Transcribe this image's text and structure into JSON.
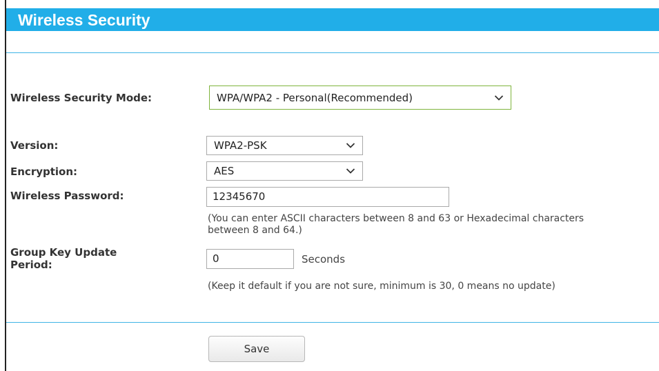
{
  "page": {
    "title": "Wireless Security"
  },
  "form": {
    "security_mode": {
      "label": "Wireless Security Mode:",
      "value": "WPA/WPA2 - Personal(Recommended)"
    },
    "version": {
      "label": "Version:",
      "value": "WPA2-PSK"
    },
    "encryption": {
      "label": "Encryption:",
      "value": "AES"
    },
    "password": {
      "label": "Wireless Password:",
      "value": "12345670",
      "hint_line1": "(You can enter ASCII characters between 8 and 63 or Hexadecimal characters",
      "hint_line2": "between 8 and 64.)"
    },
    "group_key": {
      "label_line1": "Group Key Update",
      "label_line2": "Period:",
      "value": "0",
      "unit": "Seconds",
      "hint": "(Keep it default if you are not sure, minimum is 30, 0 means no update)"
    }
  },
  "actions": {
    "save_label": "Save"
  },
  "colors": {
    "title_bar": "#21aee8",
    "rule": "#3eb4e6",
    "mode_select_border": "#7fb43c"
  },
  "icons": {
    "dropdown": "chevron-down-icon"
  }
}
